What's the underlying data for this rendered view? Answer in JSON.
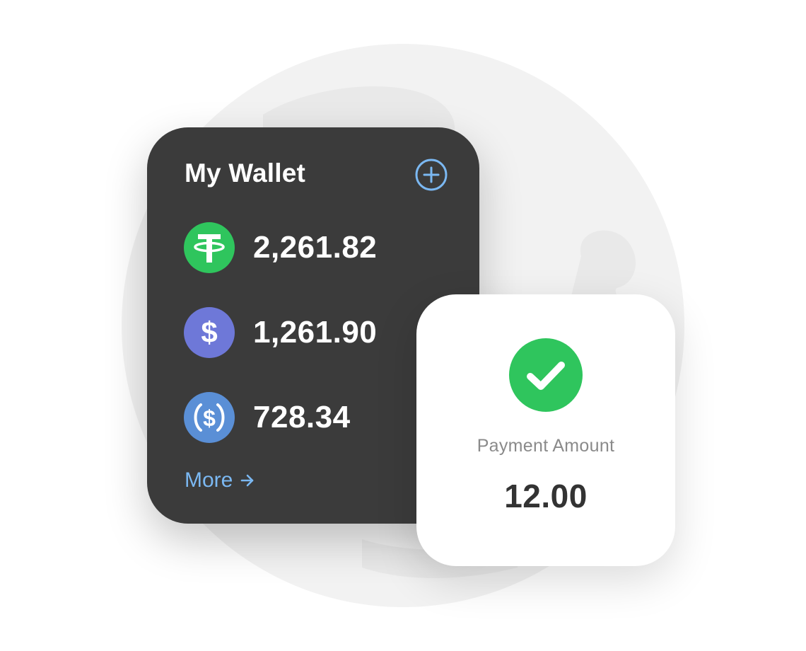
{
  "wallet": {
    "title": "My Wallet",
    "add_icon": "plus-circle-icon",
    "coins": [
      {
        "icon": "tether-icon",
        "amount": "2,261.82",
        "color": "#2fc55d"
      },
      {
        "icon": "dollar-icon",
        "amount": "1,261.90",
        "color": "#6e78d8"
      },
      {
        "icon": "usd-coin-icon",
        "amount": "728.34",
        "color": "#5a8fd6"
      }
    ],
    "more_label": "More",
    "more_icon": "arrow-right-icon"
  },
  "payment": {
    "status_icon": "check-circle-icon",
    "label": "Payment Amount",
    "amount": "12.00"
  },
  "colors": {
    "wallet_bg": "#3b3b3b",
    "accent": "#7bb8f2",
    "success": "#2fc55d",
    "background_circle": "#f2f2f2"
  }
}
